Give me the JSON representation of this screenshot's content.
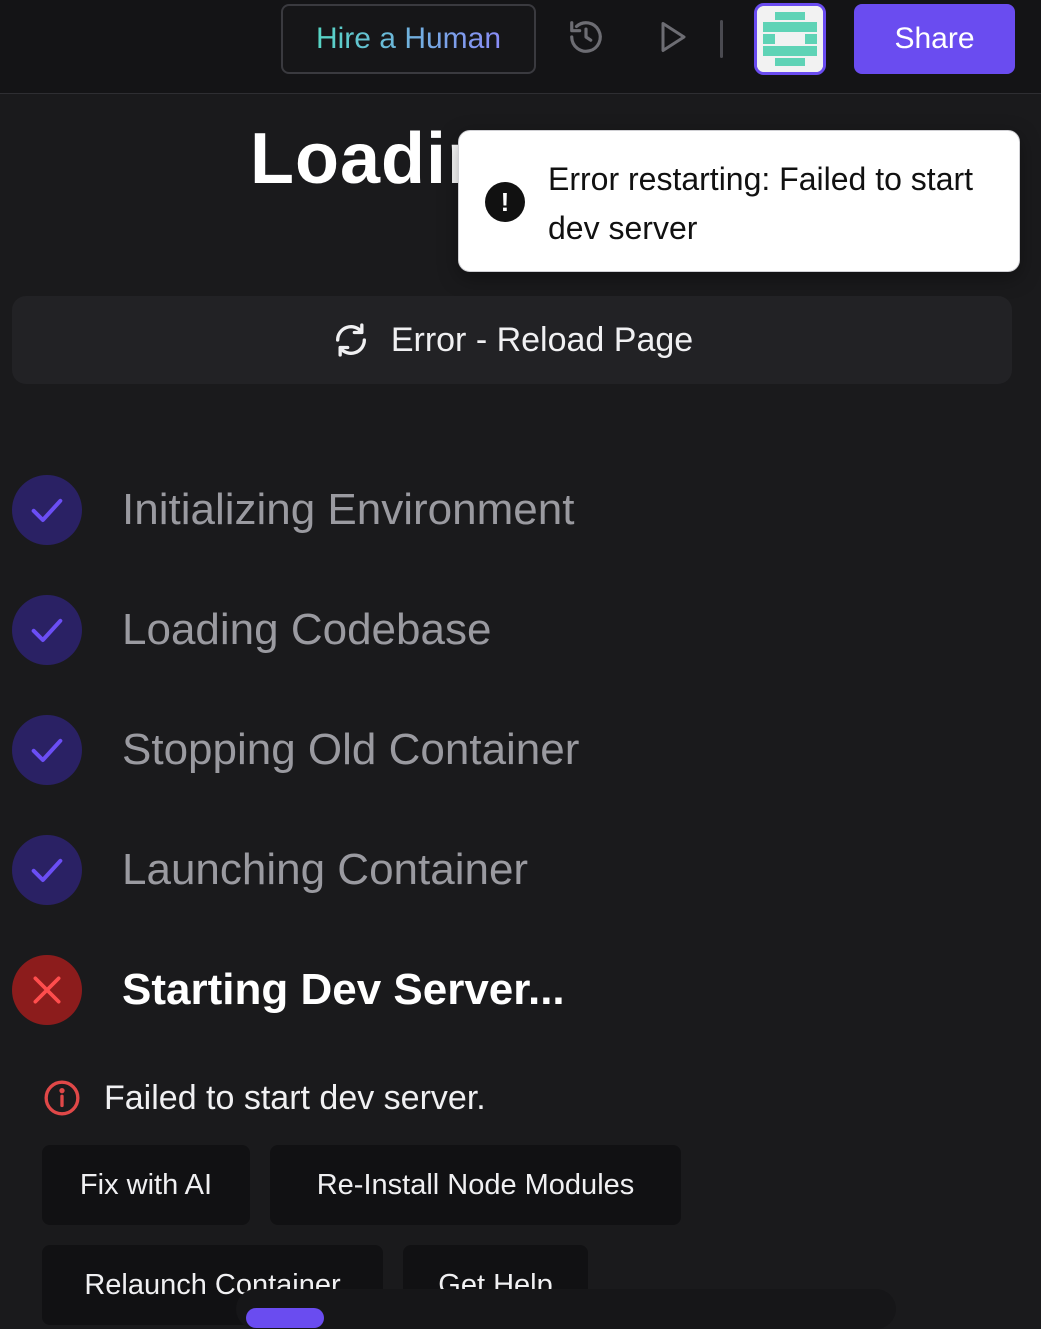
{
  "topbar": {
    "hire_label": "Hire a Human",
    "history_icon": "history-icon",
    "play_icon": "play-icon",
    "share_label": "Share",
    "accent_color": "#6a4cf0"
  },
  "main": {
    "title": "Loadin",
    "reload_label": "Error - Reload Page"
  },
  "toast": {
    "message": "Error restarting: Failed to start dev server"
  },
  "steps": [
    {
      "label": "Initializing Environment",
      "status": "done"
    },
    {
      "label": "Loading Codebase",
      "status": "done"
    },
    {
      "label": "Stopping Old Container",
      "status": "done"
    },
    {
      "label": "Launching Container",
      "status": "done"
    },
    {
      "label": "Starting Dev Server...",
      "status": "failed"
    }
  ],
  "error": {
    "message": "Failed to start dev server."
  },
  "actions": {
    "fix_ai": "Fix with AI",
    "reinstall": "Re-Install Node Modules",
    "relaunch": "Relaunch Container",
    "help": "Get Help"
  }
}
